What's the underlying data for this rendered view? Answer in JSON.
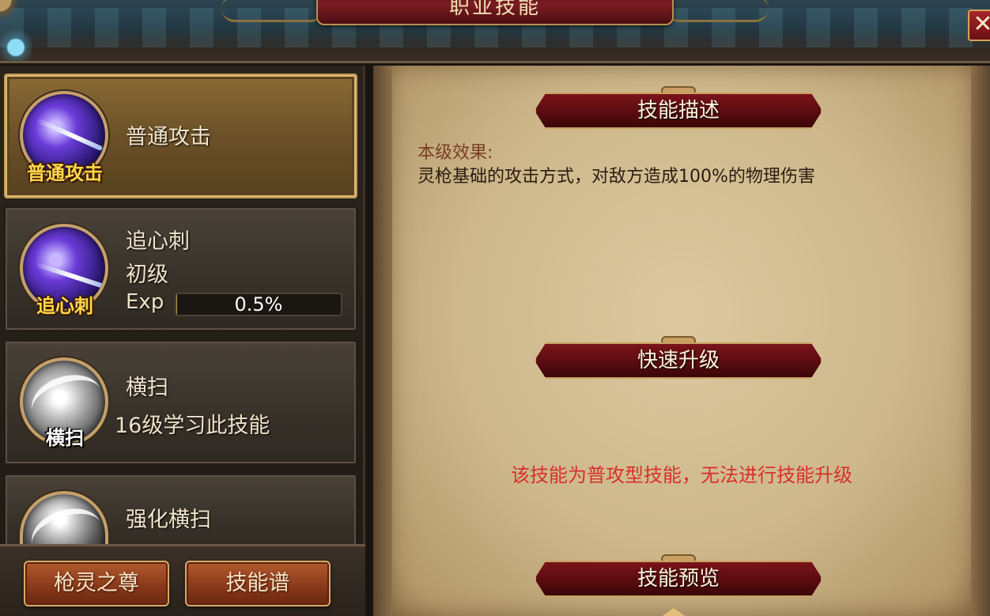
{
  "window": {
    "title": "职业技能",
    "close_label": "✕"
  },
  "skills": [
    {
      "icon_caption": "普通攻击",
      "name": "普通攻击",
      "icon": "spear-thrust-icon",
      "selected": true
    },
    {
      "icon_caption": "追心刺",
      "name": "追心刺",
      "level": "初级",
      "exp_label": "Exp",
      "exp_value": "0.5%",
      "exp_fraction": 0.005,
      "icon": "spear-pierce-icon"
    },
    {
      "icon_caption": "横扫",
      "name": "横扫",
      "requirement": "16级学习此技能",
      "icon": "sweep-icon"
    },
    {
      "name": "强化横扫",
      "icon": "enhanced-sweep-icon"
    }
  ],
  "bottom_buttons": {
    "left": "枪灵之尊",
    "right": "技能谱"
  },
  "detail": {
    "description_header": "技能描述",
    "effect_label": "本级效果:",
    "effect_text": "灵枪基础的攻击方式，对敌方造成100%的物理伤害",
    "upgrade_header": "快速升级",
    "upgrade_warning": "该技能为普攻型技能，无法进行技能升级",
    "preview_header": "技能预览"
  },
  "colors": {
    "warning": "#d8302a",
    "caption_gold": "#ffd74a",
    "banner_red": "#7a141a"
  }
}
